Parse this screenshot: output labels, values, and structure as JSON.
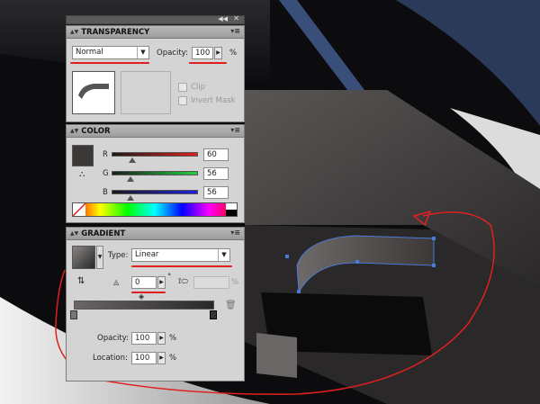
{
  "transparency": {
    "title": "TRANSPARENCY",
    "blend_mode": "Normal",
    "opacity_label": "Opacity:",
    "opacity_value": "100",
    "opacity_unit": "%",
    "clip_label": "Clip",
    "invert_mask_label": "Invert Mask"
  },
  "color": {
    "title": "COLOR",
    "channels": [
      {
        "label": "R",
        "value": "60",
        "level": 60,
        "gradient": [
          "#1a1a1a",
          "#e02020"
        ]
      },
      {
        "label": "G",
        "value": "56",
        "level": 56,
        "gradient": [
          "#1a1a1a",
          "#20d040"
        ]
      },
      {
        "label": "B",
        "value": "56",
        "level": 56,
        "gradient": [
          "#1a1a1a",
          "#2020e0"
        ]
      }
    ],
    "current_color": "#3c3838"
  },
  "gradient": {
    "title": "GRADIENT",
    "type_label": "Type:",
    "type_value": "Linear",
    "angle_value": "0",
    "angle_unit": "°",
    "aspect_unit": "%",
    "opacity_label": "Opacity:",
    "opacity_value": "100",
    "location_label": "Location:",
    "location_value": "100",
    "percent": "%"
  },
  "colors": {
    "annotation_red": "#e02020",
    "selection_blue": "#4a7ad8",
    "panel_bg": "#d4d4d4"
  }
}
